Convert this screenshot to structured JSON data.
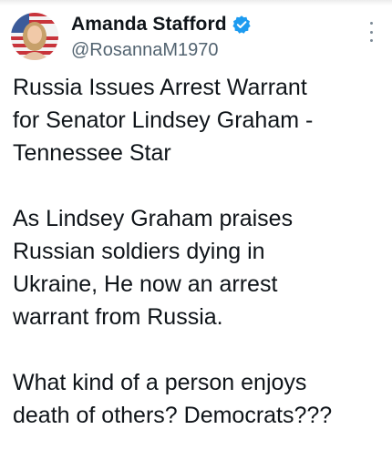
{
  "author": {
    "display_name": "Amanda Stafford",
    "handle": "@RosannaM1970",
    "verified": true
  },
  "tweet": {
    "paragraphs": [
      [
        "Russia Issues Arrest Warrant",
        "for Senator Lindsey Graham -",
        "Tennessee Star"
      ],
      [
        "As Lindsey Graham praises",
        "Russian soldiers dying in",
        "Ukraine, He now an arrest",
        "warrant from Russia."
      ],
      [
        "What kind of a person enjoys",
        "death of others? Democrats???"
      ]
    ]
  },
  "icons": {
    "verified": "verified-badge-icon",
    "more": "more-options-icon"
  },
  "colors": {
    "verified_blue": "#1d9bf0",
    "text_primary": "#0f1419",
    "text_secondary": "#536471"
  }
}
